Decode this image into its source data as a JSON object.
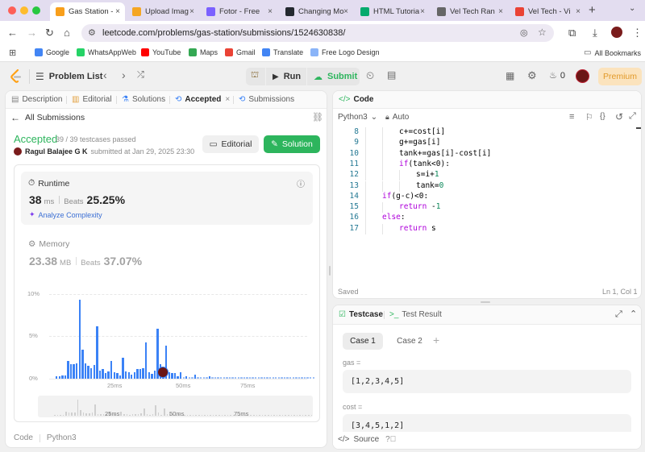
{
  "browser": {
    "tabs": [
      {
        "title": "Gas Station -",
        "active": true,
        "icon": "leetcode-favicon",
        "color": "#f89f1b"
      },
      {
        "title": "Upload Imag",
        "icon": "upload-favicon",
        "color": "#f5a623"
      },
      {
        "title": "Fotor - Free",
        "icon": "fotor-favicon",
        "color": "#7b61ff"
      },
      {
        "title": "Changing Mo",
        "icon": "github-favicon",
        "color": "#24292f"
      },
      {
        "title": "HTML Tutoria",
        "icon": "w3schools-favicon",
        "color": "#04aa6d"
      },
      {
        "title": "Vel Tech Ran",
        "icon": "globe-favicon",
        "color": "#666"
      },
      {
        "title": "Vel Tech - Vi",
        "icon": "gmail-favicon",
        "color": "#ea4335"
      }
    ],
    "url": "leetcode.com/problems/gas-station/submissions/1524630838/",
    "bookmarks": [
      {
        "label": "Google",
        "icon": "google-icon",
        "color": "#4285f4"
      },
      {
        "label": "WhatsAppWeb",
        "icon": "whatsapp-icon",
        "color": "#25d366"
      },
      {
        "label": "YouTube",
        "icon": "youtube-icon",
        "color": "#ff0000"
      },
      {
        "label": "Maps",
        "icon": "maps-icon",
        "color": "#34a853"
      },
      {
        "label": "Gmail",
        "icon": "gmail-icon",
        "color": "#ea4335"
      },
      {
        "label": "Translate",
        "icon": "translate-icon",
        "color": "#4285f4"
      },
      {
        "label": "Free Logo Design",
        "icon": "logo-design-icon",
        "color": "#8ab4f8"
      }
    ],
    "all_bookmarks": "All Bookmarks"
  },
  "header": {
    "problem_list": "Problem List",
    "run": "Run",
    "submit": "Submit",
    "streak": "0",
    "premium": "Premium"
  },
  "left_tabs": [
    "Description",
    "Editorial",
    "Solutions",
    "Accepted",
    "Submissions"
  ],
  "submission": {
    "back": "All Submissions",
    "status": "Accepted",
    "testcases": "39 / 39 testcases passed",
    "user": "Ragul Balajee G K",
    "submitted": "submitted at Jan 29, 2025 23:30",
    "editorial_btn": "Editorial",
    "solution_btn": "Solution",
    "runtime_label": "Runtime",
    "runtime_value": "38",
    "runtime_unit": "ms",
    "beats_label": "Beats",
    "runtime_beats": "25.25%",
    "analyze": "Analyze Complexity",
    "memory_label": "Memory",
    "memory_value": "23.38",
    "memory_unit": "MB",
    "memory_beats": "37.07%",
    "footer_code": "Code",
    "footer_lang": "Python3"
  },
  "colors": {
    "accepted": "#2db55d",
    "accent": "#3b82f6",
    "premium_bg": "#fbe3bd",
    "premium_text": "#e29a2a"
  },
  "chart_data": {
    "type": "bar",
    "title": "",
    "xlabel": "Runtime",
    "ylabel": "",
    "ytick_labels": [
      "10%",
      "5%",
      "0%"
    ],
    "xtick_labels": [
      "25ms",
      "50ms",
      "75ms"
    ],
    "ylim": [
      0,
      10
    ],
    "series": [
      {
        "values": [
          0.3,
          0.3,
          0.4,
          0.4,
          2.1,
          1.7,
          1.7,
          1.8,
          9.3,
          3.4,
          1.8,
          1.5,
          1.2,
          1.6,
          6.2,
          1.0,
          1.1,
          0.7,
          0.9,
          2.1,
          0.8,
          0.7,
          0.4,
          2.5,
          0.9,
          0.8,
          0.5,
          0.8,
          1.1,
          1.1,
          1.2,
          4.3,
          0.8,
          0.6,
          1.0,
          5.9,
          1.7,
          0.5,
          3.9,
          0.8,
          0.7,
          0.7,
          0.3,
          0.8,
          0.2,
          0.3,
          0.2,
          0.2,
          0.5,
          0.2,
          0.2,
          0.2,
          0.2,
          0.3,
          0.2,
          0.2,
          0.2,
          0.2,
          0.2,
          0.2,
          0.2,
          0.2,
          0.2,
          0.2,
          0.2,
          0.2,
          0.2,
          0.2,
          0.2,
          0.2,
          0.2,
          0.2,
          0.2,
          0.2,
          0.2,
          0.2,
          0.2,
          0.2,
          0.2,
          0.2,
          0.2,
          0.2,
          0.2,
          0.2,
          0.2,
          0.2,
          0.2,
          0.2,
          0.2,
          0.2
        ]
      }
    ],
    "marker_bar_index": 37,
    "grid": true
  },
  "code_panel": {
    "title": "Code",
    "lang": "Python3",
    "mode": "Auto",
    "saved": "Saved",
    "cursor": "Ln 1, Col 1",
    "lines": [
      {
        "n": "8",
        "indent": 2,
        "text": "c+=cost[i]"
      },
      {
        "n": "9",
        "indent": 2,
        "text": "g+=gas[i]"
      },
      {
        "n": "10",
        "indent": 2,
        "text": "tank+=gas[i]-cost[i]"
      },
      {
        "n": "11",
        "indent": 2,
        "text": "if(tank<0):"
      },
      {
        "n": "12",
        "indent": 3,
        "text": "s=i+1"
      },
      {
        "n": "13",
        "indent": 3,
        "text": "tank=0"
      },
      {
        "n": "14",
        "indent": 1,
        "text": "if(g-c)<0:"
      },
      {
        "n": "15",
        "indent": 2,
        "text": "return -1"
      },
      {
        "n": "16",
        "indent": 1,
        "text": "else:"
      },
      {
        "n": "17",
        "indent": 2,
        "text": "return s"
      }
    ]
  },
  "testcase_panel": {
    "tab_testcase": "Testcase",
    "tab_result": "Test Result",
    "cases": [
      "Case 1",
      "Case 2"
    ],
    "gas_label": "gas =",
    "gas_value": "[1,2,3,4,5]",
    "cost_label": "cost =",
    "cost_value": "[3,4,5,1,2]",
    "source": "Source"
  }
}
